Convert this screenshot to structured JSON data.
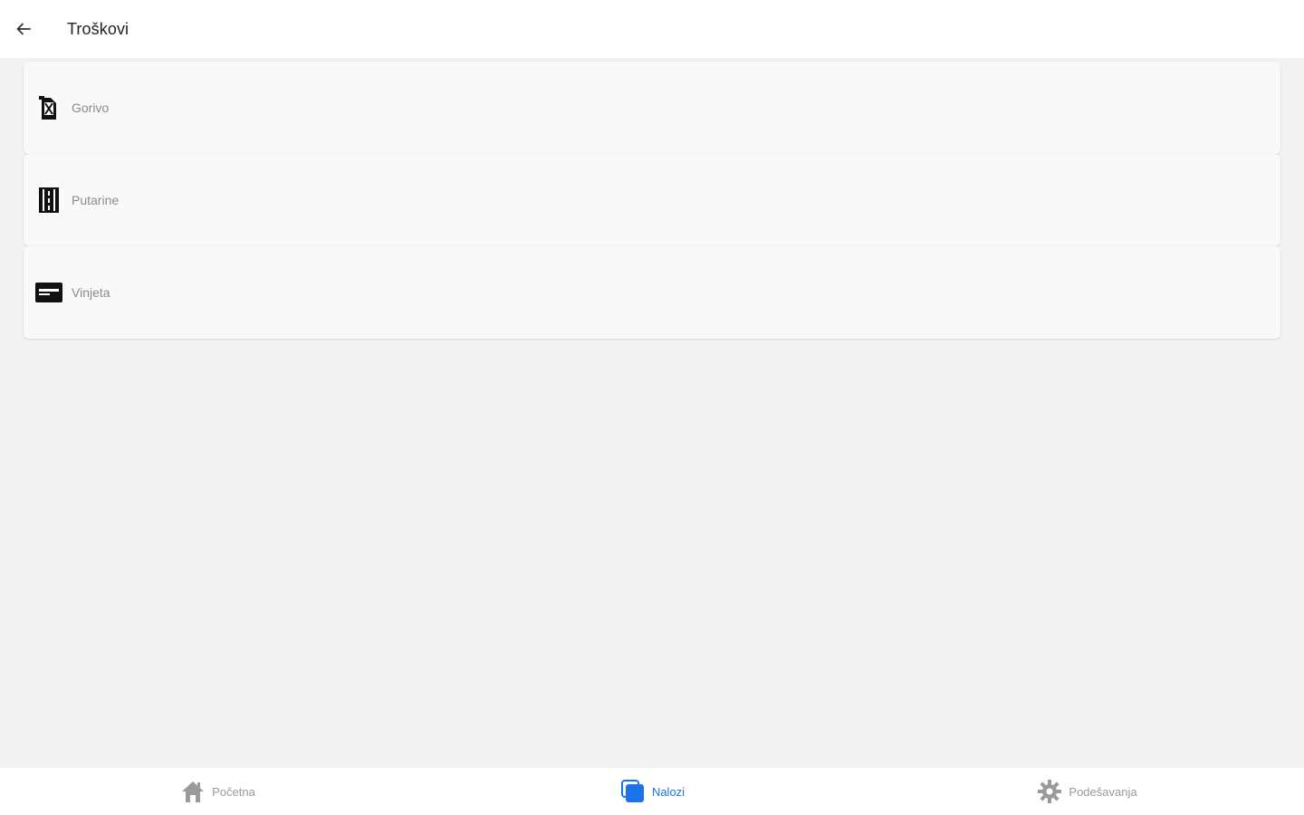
{
  "header": {
    "back_icon": "arrow-left-icon",
    "title": "Troškovi"
  },
  "expenses": [
    {
      "label": "Gorivo",
      "icon": "fuel-can-icon"
    },
    {
      "label": "Putarine",
      "icon": "toll-road-icon"
    },
    {
      "label": "Vinjeta",
      "icon": "card-icon"
    }
  ],
  "bottom_nav": {
    "items": [
      {
        "label": "Početna",
        "icon": "home-icon",
        "active": false
      },
      {
        "label": "Nalozi",
        "icon": "layers-icon",
        "active": true
      },
      {
        "label": "Podešavanja",
        "icon": "gear-icon",
        "active": false
      }
    ]
  },
  "colors": {
    "accent": "#1a73e8",
    "background": "#f2f2f2",
    "card": "#f9f9f9",
    "inactive_nav": "#9a9a9a"
  }
}
